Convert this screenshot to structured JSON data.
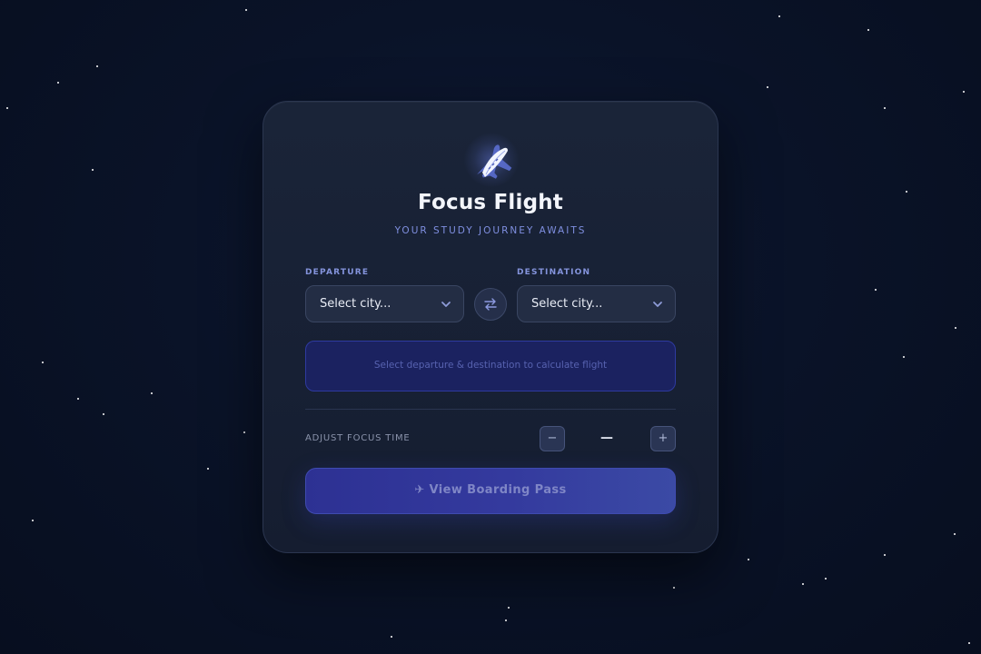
{
  "app": {
    "title": "Focus Flight",
    "subtitle": "YOUR STUDY JOURNEY AWAITS",
    "logo_icon": "airplane-icon"
  },
  "route": {
    "departure": {
      "label": "DEPARTURE",
      "value": "Select city..."
    },
    "destination": {
      "label": "DESTINATION",
      "value": "Select city..."
    },
    "swap_icon": "swap-arrows-icon"
  },
  "info": {
    "message": "Select departure & destination to calculate flight"
  },
  "focus_time": {
    "label": "ADJUST FOCUS TIME",
    "decrease_label": "−",
    "value": "—",
    "increase_label": "+"
  },
  "cta": {
    "label": "✈ View Boarding Pass"
  },
  "colors": {
    "background": "#0a1328",
    "card": "#182136",
    "accent": "#7f8fe0",
    "info_box": "#1b2260",
    "button": "#343a9e"
  }
}
